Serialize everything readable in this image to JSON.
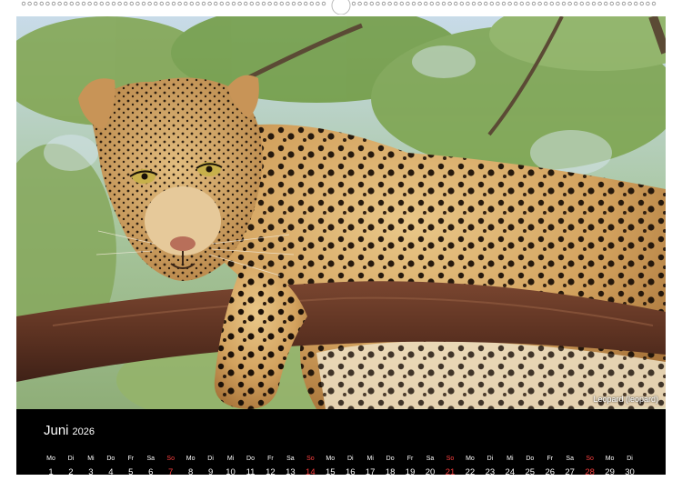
{
  "photo": {
    "subject": "leopard lying on a tree branch",
    "caption": "Leopard (leopard)"
  },
  "calendar": {
    "month": "Juni",
    "year": "2026",
    "days": [
      {
        "wd": "Mo",
        "num": "1"
      },
      {
        "wd": "Di",
        "num": "2"
      },
      {
        "wd": "Mi",
        "num": "3"
      },
      {
        "wd": "Do",
        "num": "4"
      },
      {
        "wd": "Fr",
        "num": "5"
      },
      {
        "wd": "Sa",
        "num": "6"
      },
      {
        "wd": "So",
        "num": "7"
      },
      {
        "wd": "Mo",
        "num": "8"
      },
      {
        "wd": "Di",
        "num": "9"
      },
      {
        "wd": "Mi",
        "num": "10"
      },
      {
        "wd": "Do",
        "num": "11"
      },
      {
        "wd": "Fr",
        "num": "12"
      },
      {
        "wd": "Sa",
        "num": "13"
      },
      {
        "wd": "So",
        "num": "14"
      },
      {
        "wd": "Mo",
        "num": "15"
      },
      {
        "wd": "Di",
        "num": "16"
      },
      {
        "wd": "Mi",
        "num": "17"
      },
      {
        "wd": "Do",
        "num": "18"
      },
      {
        "wd": "Fr",
        "num": "19"
      },
      {
        "wd": "Sa",
        "num": "20"
      },
      {
        "wd": "So",
        "num": "21"
      },
      {
        "wd": "Mo",
        "num": "22"
      },
      {
        "wd": "Di",
        "num": "23"
      },
      {
        "wd": "Mi",
        "num": "24"
      },
      {
        "wd": "Do",
        "num": "25"
      },
      {
        "wd": "Fr",
        "num": "26"
      },
      {
        "wd": "Sa",
        "num": "27"
      },
      {
        "wd": "So",
        "num": "28"
      },
      {
        "wd": "Mo",
        "num": "29"
      },
      {
        "wd": "Di",
        "num": "30"
      }
    ]
  },
  "colors": {
    "sunday": "#ff4040",
    "background": "#000000",
    "text": "#ffffff"
  }
}
